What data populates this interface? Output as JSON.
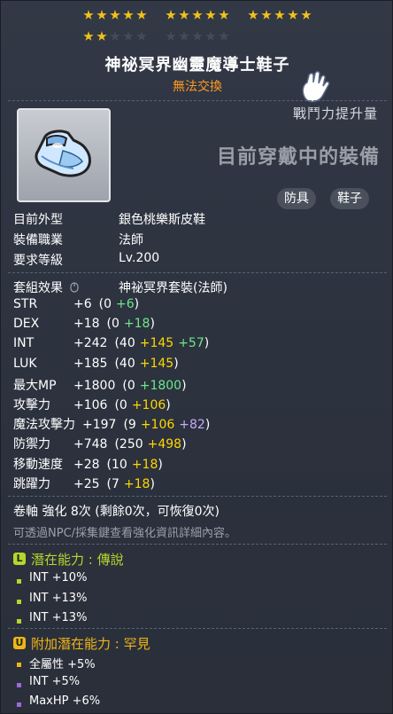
{
  "stars": {
    "filled": 17,
    "empty": 8,
    "total": 25,
    "filled_color": "#f2c21b",
    "empty_color": "#454b57"
  },
  "item": {
    "name": "神祕冥界幽靈魔導士鞋子",
    "trade_status": "無法交換",
    "power_label": "戰鬥力提升量",
    "equip_status": "目前穿戴中的裝備",
    "tags": [
      "防具",
      "鞋子"
    ]
  },
  "info": {
    "appearance_label": "目前外型",
    "appearance_value": "銀色桃樂斯皮鞋",
    "job_label": "裝備職業",
    "job_value": "法師",
    "level_label": "要求等級",
    "level_value": "Lv.200"
  },
  "set": {
    "label": "套組效果",
    "value": "神祕冥界套裝(法師)"
  },
  "stats": [
    {
      "label": "STR",
      "total": "+6",
      "open": "(0",
      "parts": [
        {
          "text": "+6",
          "color": "green"
        }
      ],
      "close": ")"
    },
    {
      "label": "DEX",
      "total": "+18",
      "open": "(0",
      "parts": [
        {
          "text": "+18",
          "color": "green"
        }
      ],
      "close": ")"
    },
    {
      "label": "INT",
      "total": "+242",
      "open": "(40",
      "parts": [
        {
          "text": "+145",
          "color": "yellow"
        },
        {
          "text": "+57",
          "color": "green"
        }
      ],
      "close": ")"
    },
    {
      "label": "LUK",
      "total": "+185",
      "open": "(40",
      "parts": [
        {
          "text": "+145",
          "color": "yellow"
        }
      ],
      "close": ")"
    },
    {
      "label": "最大MP",
      "total": "+1800",
      "open": "(0",
      "parts": [
        {
          "text": "+1800",
          "color": "green"
        }
      ],
      "close": ")"
    },
    {
      "label": "攻擊力",
      "total": "+106",
      "open": "(0",
      "parts": [
        {
          "text": "+106",
          "color": "yellow"
        }
      ],
      "close": ")"
    },
    {
      "label": "魔法攻擊力",
      "total": "+197",
      "open": "(9",
      "parts": [
        {
          "text": "+106",
          "color": "yellow"
        },
        {
          "text": "+82",
          "color": "purple"
        }
      ],
      "close": ")"
    },
    {
      "label": "防禦力",
      "total": "+748",
      "open": "(250",
      "parts": [
        {
          "text": "+498",
          "color": "yellow"
        }
      ],
      "close": ")"
    },
    {
      "label": "移動速度",
      "total": "+28",
      "open": "(10",
      "parts": [
        {
          "text": "+18",
          "color": "yellow"
        }
      ],
      "close": ")"
    },
    {
      "label": "跳躍力",
      "total": "+25",
      "open": "(7",
      "parts": [
        {
          "text": "+18",
          "color": "yellow"
        }
      ],
      "close": ")"
    }
  ],
  "scroll": {
    "text": "卷軸 強化 8次 (剩餘0次，可恢復0次)",
    "note": "可透過NPC/採集鍵查看強化資訊詳細內容。"
  },
  "potential": {
    "icon": "L",
    "label": "潛在能力 : 傳說",
    "color": "#b4d62d",
    "lines": [
      "INT +10%",
      "INT +13%",
      "INT +13%"
    ]
  },
  "additional": {
    "icon": "U",
    "label": "附加潛在能力 : 罕見",
    "color": "#f0b418",
    "lines": [
      "全屬性 +5%",
      "INT +5%",
      "MaxHP +6%"
    ],
    "bullet_colors": [
      "#f0b418",
      "#9b6bd9",
      "#9b6bd9"
    ]
  },
  "colors": {
    "green": "#6de88a",
    "yellow": "#ffd600",
    "purple": "#c7a8ff"
  }
}
